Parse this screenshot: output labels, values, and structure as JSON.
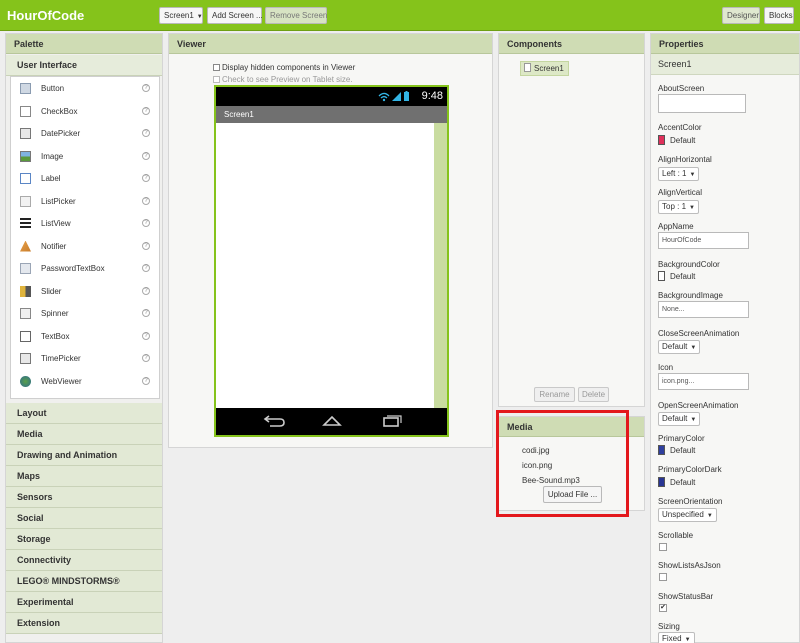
{
  "app": {
    "title": "HourOfCode",
    "screen_select": "Screen1",
    "add_screen": "Add Screen ...",
    "remove_screen": "Remove Screen",
    "designer": "Designer",
    "blocks": "Blocks",
    "accent": "#85c31b"
  },
  "palette": {
    "title": "Palette",
    "open_category": "User Interface",
    "items": [
      {
        "label": "Button",
        "icon": "button-icon"
      },
      {
        "label": "CheckBox",
        "icon": "checkbox-icon"
      },
      {
        "label": "DatePicker",
        "icon": "datepicker-icon"
      },
      {
        "label": "Image",
        "icon": "image-icon"
      },
      {
        "label": "Label",
        "icon": "label-icon"
      },
      {
        "label": "ListPicker",
        "icon": "listpicker-icon"
      },
      {
        "label": "ListView",
        "icon": "listview-icon"
      },
      {
        "label": "Notifier",
        "icon": "notifier-icon"
      },
      {
        "label": "PasswordTextBox",
        "icon": "password-icon"
      },
      {
        "label": "Slider",
        "icon": "slider-icon"
      },
      {
        "label": "Spinner",
        "icon": "spinner-icon"
      },
      {
        "label": "TextBox",
        "icon": "textbox-icon"
      },
      {
        "label": "TimePicker",
        "icon": "timepicker-icon"
      },
      {
        "label": "WebViewer",
        "icon": "webviewer-icon"
      }
    ],
    "help": "?",
    "categories": [
      "Layout",
      "Media",
      "Drawing and Animation",
      "Maps",
      "Sensors",
      "Social",
      "Storage",
      "Connectivity",
      "LEGO® MINDSTORMS®",
      "Experimental",
      "Extension"
    ]
  },
  "viewer": {
    "title": "Viewer",
    "hidden_components": "Display hidden components in Viewer",
    "tablet_preview": "Check to see Preview on Tablet size.",
    "time": "9:48",
    "screen_title": "Screen1"
  },
  "components": {
    "title": "Components",
    "root": "Screen1",
    "rename": "Rename",
    "delete": "Delete"
  },
  "media": {
    "title": "Media",
    "files": [
      "codi.jpg",
      "icon.png",
      "Bee-Sound.mp3"
    ],
    "upload": "Upload File ...",
    "highlight_color": "#e3171c"
  },
  "properties": {
    "title": "Properties",
    "component": "Screen1",
    "about_screen": "AboutScreen",
    "accent_color": "AccentColor",
    "accent_value": "Default",
    "accent_swatch": "#e0305a",
    "align_h": "AlignHorizontal",
    "align_h_value": "Left : 1",
    "align_v": "AlignVertical",
    "align_v_value": "Top : 1",
    "app_name": "AppName",
    "app_name_value": "HourOfCode",
    "bg_color": "BackgroundColor",
    "bg_color_value": "Default",
    "bg_image": "BackgroundImage",
    "bg_image_value": "None...",
    "close_anim": "CloseScreenAnimation",
    "close_anim_value": "Default",
    "icon": "Icon",
    "icon_value": "icon.png...",
    "open_anim": "OpenScreenAnimation",
    "open_anim_value": "Default",
    "primary_color": "PrimaryColor",
    "primary_value": "Default",
    "primary_swatch": "#2f3f9e",
    "primary_dark": "PrimaryColorDark",
    "primary_dark_value": "Default",
    "primary_dark_swatch": "#283593",
    "orientation": "ScreenOrientation",
    "orientation_value": "Unspecified",
    "scrollable": "Scrollable",
    "show_lists": "ShowListsAsJson",
    "show_status": "ShowStatusBar",
    "status_check": "✔",
    "sizing": "Sizing",
    "sizing_value": "Fixed"
  }
}
